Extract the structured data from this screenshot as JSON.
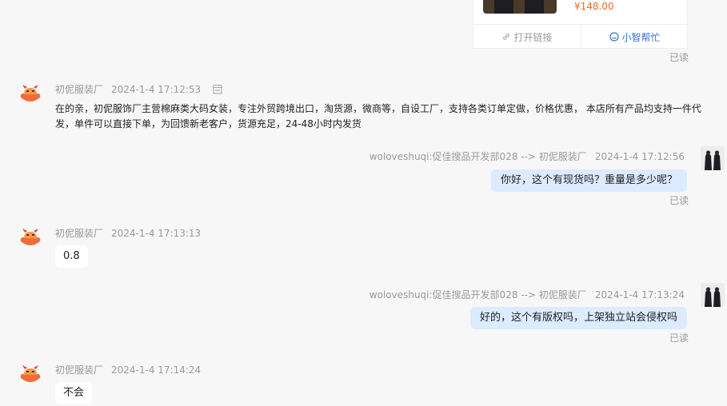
{
  "product_card": {
    "price": "¥148.00",
    "open_link_label": "打开链接",
    "help_label": "小智帮忙"
  },
  "read_label": "已读",
  "messages": [
    {
      "sender": "初伲服装厂",
      "time": "2024-1-4 17:12:53",
      "text": "在的亲，初伲服饰厂主营棉麻类大码女装，专注外贸跨境出口，淘货源，微商等，自设工厂，支持各类订单定做，价格优惠， 本店所有产品均支持一件代发，单件可以直接下单，为回馈新老客户，货源充足，24-48小时内发货"
    },
    {
      "sender": "woloveshuqi:促佳搜品开发部028 --> 初伲服装厂",
      "time": "2024-1-4 17:12:56",
      "text": "你好，这个有现货吗？重量是多少呢？"
    },
    {
      "sender": "初伲服装厂",
      "time": "2024-1-4 17:13:13",
      "text": "0.8"
    },
    {
      "sender": "woloveshuqi:促佳搜品开发部028 --> 初伲服装厂",
      "time": "2024-1-4 17:13:24",
      "text": "好的，这个有版权吗，上架独立站会侵权吗"
    },
    {
      "sender": "初伲服装厂",
      "time": "2024-1-4 17:14:24",
      "text": "不会"
    }
  ]
}
